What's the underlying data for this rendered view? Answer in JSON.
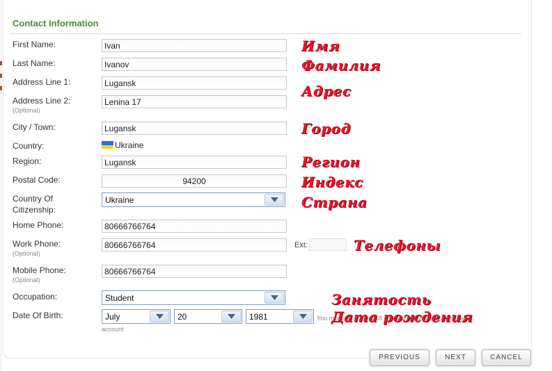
{
  "section_title": "Contact Information",
  "optional_label": "(Optional)",
  "fields": {
    "first_name": {
      "label": "First Name:",
      "value": "Ivan"
    },
    "last_name": {
      "label": "Last Name:",
      "value": "Ivanov"
    },
    "address1": {
      "label": "Address Line 1:",
      "value": "Lugansk"
    },
    "address2": {
      "label": "Address Line 2:",
      "value": "Lenina 17"
    },
    "city": {
      "label": "City / Town:",
      "value": "Lugansk"
    },
    "country": {
      "label": "Country:",
      "value": "Ukraine"
    },
    "region": {
      "label": "Region:",
      "value": "Lugansk"
    },
    "postal": {
      "label": "Postal Code:",
      "value": "94200"
    },
    "citizenship": {
      "label1": "Country Of",
      "label2": "Citizenship:",
      "value": "Ukraine"
    },
    "home_phone": {
      "label": "Home Phone:",
      "value": "80666766764"
    },
    "work_phone": {
      "label": "Work Phone:",
      "value": "80666766764",
      "ext_label": "Ext:",
      "ext_value": ""
    },
    "mobile_phone": {
      "label": "Mobile Phone:",
      "value": "80666766764"
    },
    "occupation": {
      "label": "Occupation:",
      "value": "Student"
    },
    "dob": {
      "label": "Date Of Birth:",
      "month": "July",
      "day": "20",
      "year": "1981"
    }
  },
  "dob_note": "You must be at least 18 years or older for an AlertPay",
  "dob_note2": "account",
  "annotations": {
    "first_name": "Имя",
    "last_name": "Фамилия",
    "address": "Адрес",
    "city": "Город",
    "region": "Регион",
    "postal": "Индекс",
    "country": "Страна",
    "phones": "Телефоны",
    "occupation": "Занятость",
    "dob": "Дата рождения"
  },
  "buttons": {
    "previous": "PREVIOUS",
    "next": "NEXT",
    "cancel": "CANCEL"
  },
  "colors": {
    "title": "#3f8f2c",
    "annotation": "#e4162b",
    "flag_blue": "#2b6dd8",
    "flag_yellow": "#f7d21c"
  },
  "icons": {
    "dropdown": "chevron-down-icon",
    "flag": "ukraine-flag-icon"
  }
}
